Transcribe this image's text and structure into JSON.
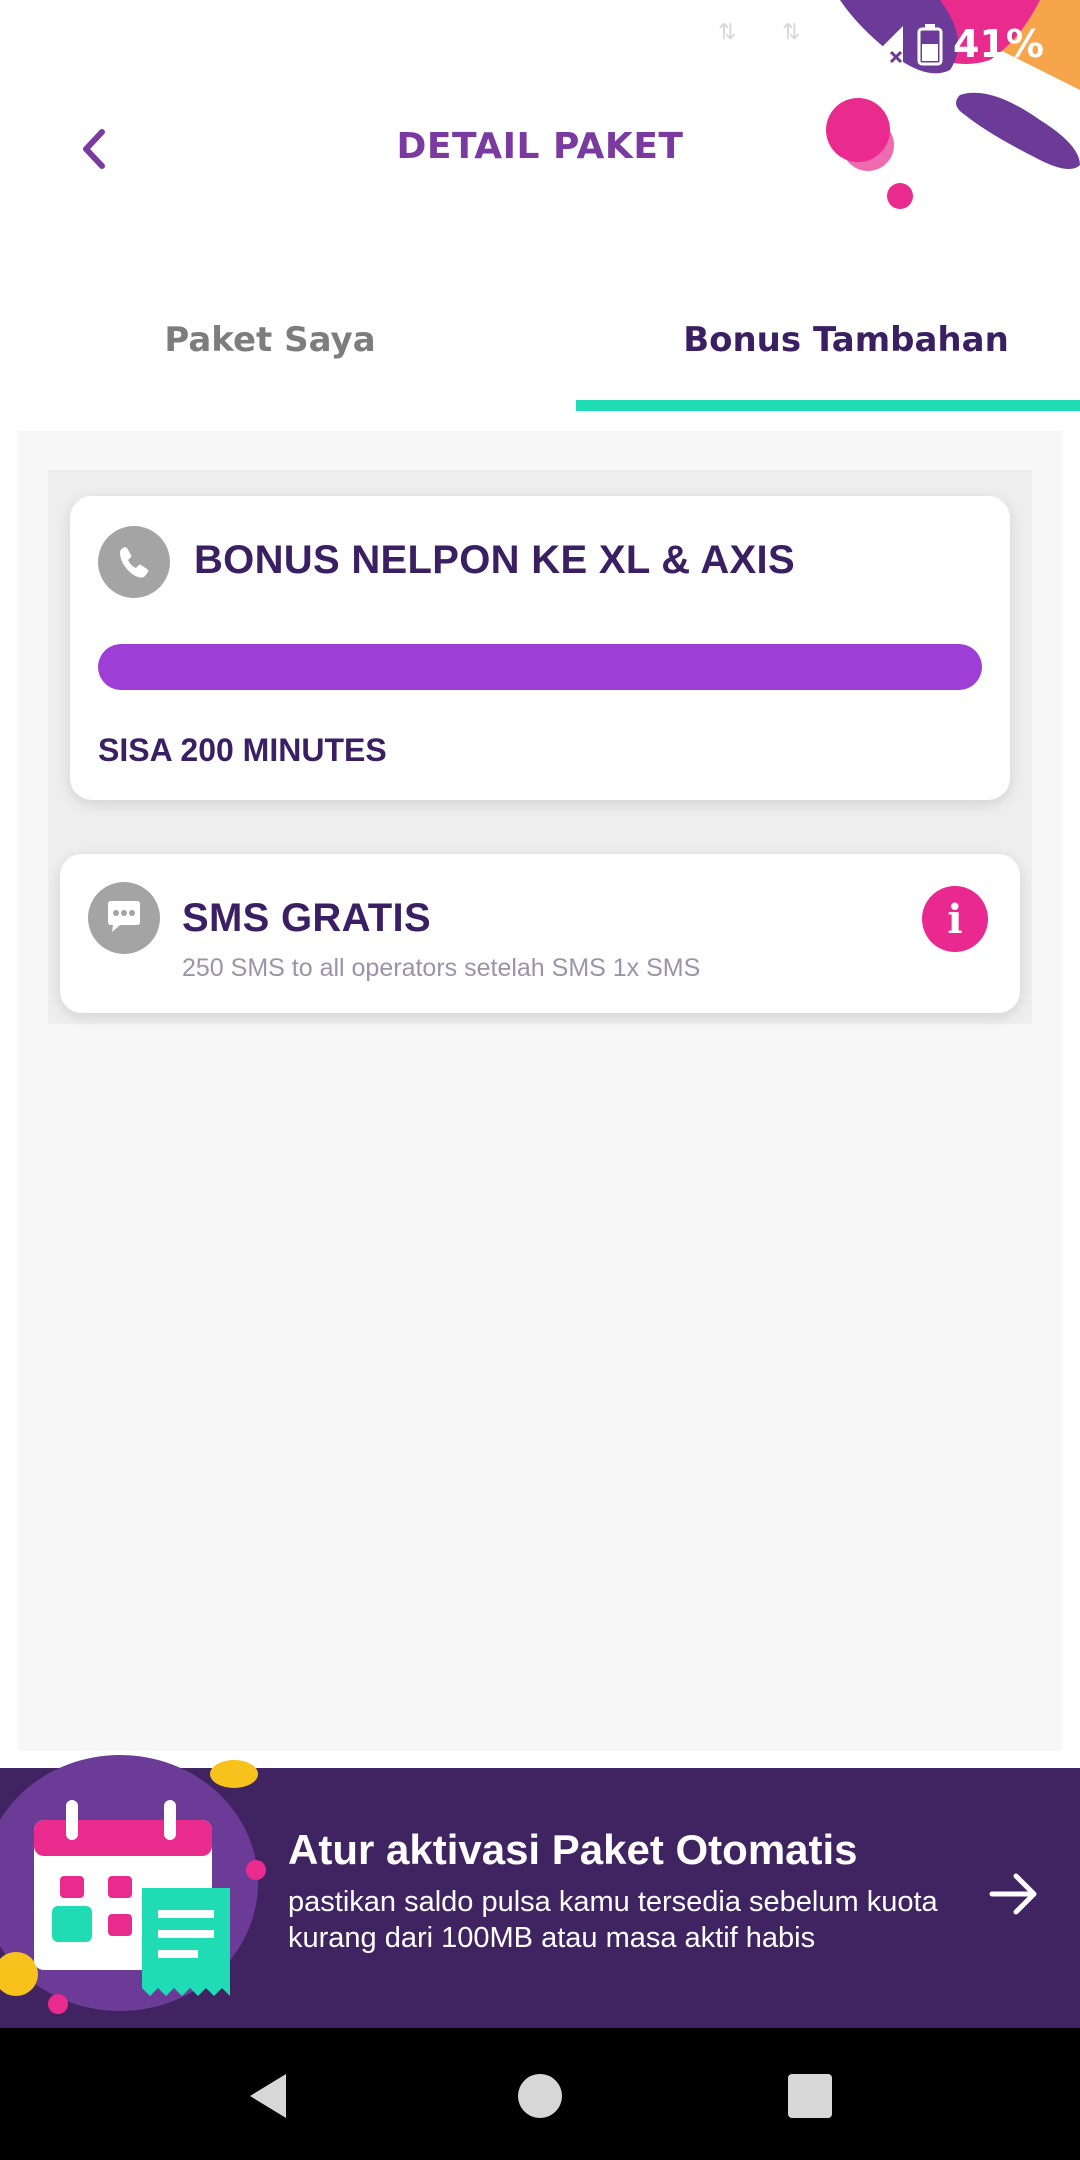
{
  "status_bar": {
    "battery_text": "41%"
  },
  "header": {
    "title": "DETAIL PAKET"
  },
  "tabs": [
    {
      "label": "Paket Saya",
      "active": false
    },
    {
      "label": "Bonus Tambahan",
      "active": true
    }
  ],
  "bonus_call": {
    "title": "BONUS NELPON KE XL & AXIS",
    "remaining": "SISA 200 MINUTES",
    "progress_fraction": 1.0
  },
  "bonus_sms": {
    "title": "SMS GRATIS",
    "description": "250 SMS to all operators setelah SMS 1x SMS"
  },
  "banner": {
    "title": "Atur aktivasi Paket Otomatis",
    "description": "pastikan saldo pulsa kamu tersedia sebelum kuota kurang dari 100MB atau masa aktif habis"
  },
  "colors": {
    "accent_purple": "#7b3aa0",
    "dark_purple": "#3a1f63",
    "progress": "#9d3fd7",
    "tab_indicator": "#1fdcb5",
    "info_pink": "#ea2990",
    "banner_bg": "#402461"
  },
  "icons": {
    "back": "chevron-left-icon",
    "call": "phone-icon",
    "sms": "chat-bubble-icon",
    "info": "info-icon",
    "banner_arrow": "arrow-right-icon",
    "nav_back": "triangle-back-icon",
    "nav_home": "circle-home-icon",
    "nav_recents": "square-recents-icon"
  }
}
